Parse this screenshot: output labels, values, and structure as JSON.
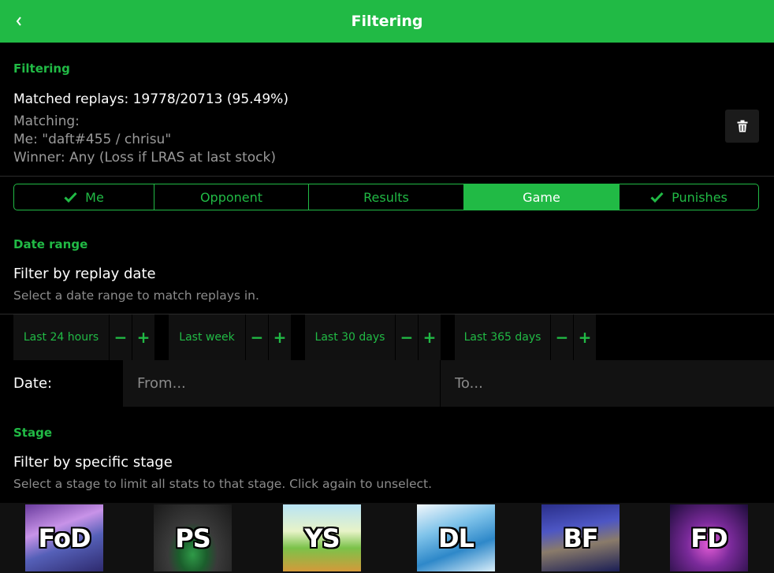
{
  "header": {
    "title": "Filtering"
  },
  "filtering": {
    "heading": "Filtering",
    "matched": "Matched replays: 19778/20713 (95.49%)",
    "matching_label": "Matching:",
    "me_line": "Me: \"daft#455 / chrisu\"",
    "winner_line": "Winner: Any (Loss if LRAS at last stock)"
  },
  "tabs": [
    {
      "label": "Me",
      "checked": true
    },
    {
      "label": "Opponent",
      "checked": false
    },
    {
      "label": "Results",
      "checked": false
    },
    {
      "label": "Game",
      "checked": false,
      "active": true
    },
    {
      "label": "Punishes",
      "checked": true
    }
  ],
  "date_range": {
    "heading": "Date range",
    "title": "Filter by replay date",
    "description": "Select a date range to match replays in.",
    "presets": [
      "Last 24 hours",
      "Last week",
      "Last 30 days",
      "Last 365 days"
    ],
    "minus": "−",
    "plus": "+",
    "date_label": "Date:",
    "from_placeholder": "From...",
    "to_placeholder": "To..."
  },
  "stage": {
    "heading": "Stage",
    "title": "Filter by specific stage",
    "description": "Select a stage to limit all stats to that stage. Click again to unselect.",
    "stages": [
      "FoD",
      "PS",
      "YS",
      "DL",
      "BF",
      "FD"
    ]
  },
  "colors": {
    "accent": "#21ba45",
    "background": "#000000",
    "panel": "#111111"
  }
}
